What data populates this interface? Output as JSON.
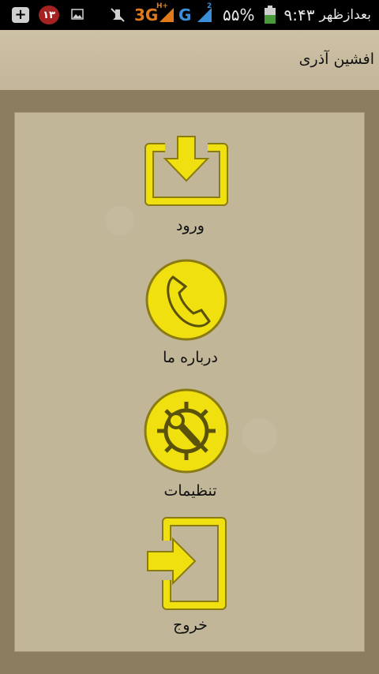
{
  "status_bar": {
    "badge_count": "۱۳",
    "network_3g": "3G",
    "network_hplus": "H+",
    "network_g": "G",
    "sim_number": "2",
    "battery_percent": "۵۵%",
    "time": "۹:۴۳",
    "ampm": "بعدازظهر",
    "icons": [
      "add-icon",
      "notification-badge",
      "image-icon",
      "mute-icon",
      "signal-icon",
      "signal-icon",
      "battery-icon"
    ]
  },
  "header": {
    "title": "افشین آذری"
  },
  "menu": {
    "items": [
      {
        "label": "ورود",
        "icon": "login-icon"
      },
      {
        "label": "درباره ما",
        "icon": "phone-icon"
      },
      {
        "label": "تنظیمات",
        "icon": "settings-icon"
      },
      {
        "label": "خروج",
        "icon": "exit-icon"
      }
    ]
  },
  "colors": {
    "icon_fill": "#f0e010",
    "icon_stroke": "#8a7c10",
    "panel": "#c2b698",
    "background": "#8c7d5f"
  }
}
